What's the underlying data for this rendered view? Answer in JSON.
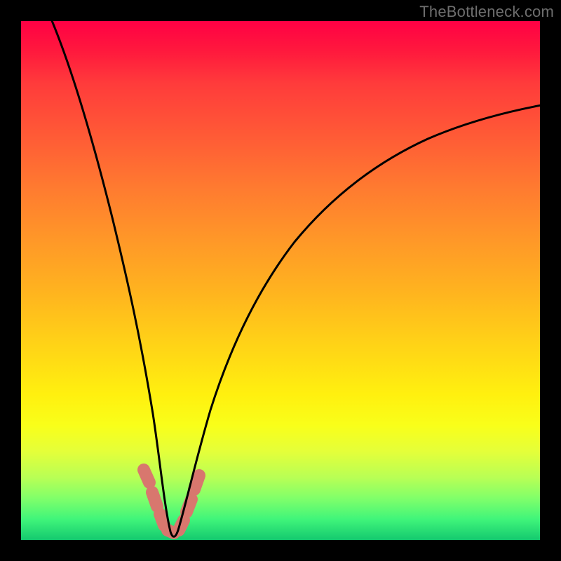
{
  "watermark": "TheBottleneck.com",
  "colors": {
    "frame": "#000000",
    "gradient_top": "#ff0044",
    "gradient_bottom": "#14c96f",
    "curve": "#000000",
    "beads": "#d8776e"
  },
  "chart_data": {
    "type": "line",
    "title": "",
    "xlabel": "",
    "ylabel": "",
    "xlim": [
      0,
      100
    ],
    "ylim": [
      0,
      100
    ],
    "grid": false,
    "legend": false,
    "annotations": [
      "TheBottleneck.com"
    ],
    "description": "V-shaped bottleneck curve: a single dark line descends steeply from the top-left, reaches a narrow minimum near x≈28 at y≈0, then rises and curves off to the upper right. Background is a vertical heat gradient from red (high bottleneck) through orange/yellow to green (low bottleneck). Pink bead segments sit on the curve around the minimum.",
    "series": [
      {
        "name": "bottleneck-curve",
        "x": [
          0,
          5,
          10,
          15,
          20,
          24,
          26,
          28,
          30,
          32,
          36,
          42,
          50,
          60,
          72,
          86,
          100
        ],
        "y": [
          100,
          86,
          70,
          53,
          33,
          13,
          4,
          0,
          2,
          6,
          17,
          32,
          46,
          58,
          68,
          76,
          80
        ]
      }
    ],
    "beads_x": [
      23.5,
      25.0,
      26.5,
      28.0,
      29.5,
      31.0,
      32.3
    ],
    "minimum": {
      "x": 28,
      "y": 0
    }
  }
}
